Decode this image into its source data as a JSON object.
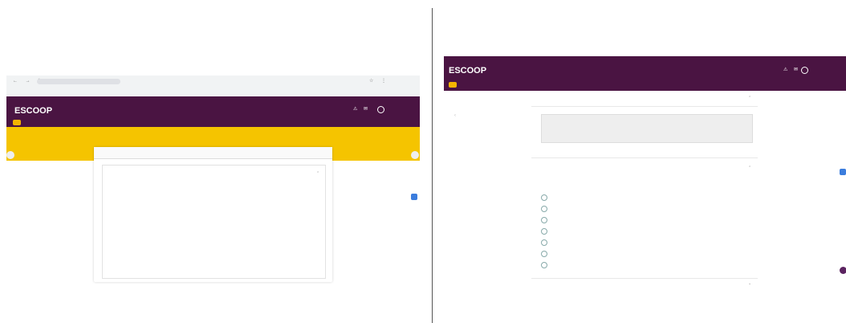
{
  "left": {
    "browser": {
      "url": "",
      "nav_icons": "← → ↻",
      "right_icons": "☆ ⋮",
      "bookmarks": ""
    },
    "header": {
      "top_info": "",
      "logo": "ESCOOP",
      "menu": [
        "",
        ""
      ],
      "icons": "⚠ ✉",
      "user_name": "",
      "subnav": [
        "",
        "",
        "",
        "",
        "",
        ""
      ]
    },
    "alert": {
      "text": "",
      "button": ""
    },
    "card": {
      "title": "",
      "section": "",
      "greeting": "",
      "p1": "",
      "p2": "",
      "list": []
    }
  },
  "right": {
    "header": {
      "top_info": "",
      "dots": "",
      "logo": "ESCOOP",
      "menu": [
        "",
        ""
      ],
      "icons": "⚠ ✉",
      "user_name": "",
      "subnav": [
        "",
        "",
        "",
        "",
        "",
        ""
      ]
    },
    "section1": {
      "title": "",
      "box_text": ""
    },
    "section2": {
      "title": "",
      "intro": "",
      "items": [
        "",
        "",
        "",
        "",
        "",
        "",
        ""
      ]
    },
    "section3": {
      "title": ""
    }
  },
  "colors": {
    "brand_purple": "#4a1442",
    "accent_yellow": "#f5c400",
    "fab_blue": "#3b7ddd"
  }
}
